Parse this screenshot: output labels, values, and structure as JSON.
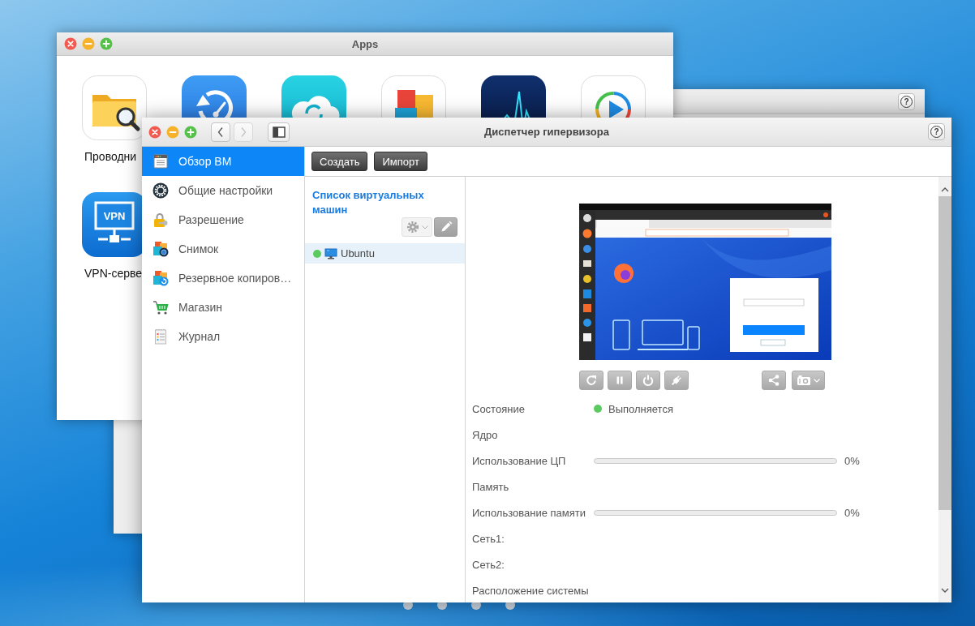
{
  "apps_window": {
    "title": "Apps",
    "apps": [
      {
        "kind": "explorer",
        "label": "Проводни"
      },
      {
        "kind": "backup"
      },
      {
        "kind": "cloud"
      },
      {
        "kind": "blocks"
      },
      {
        "kind": "pulse"
      },
      {
        "kind": "player"
      },
      {
        "kind": "vpn",
        "icon_text": "VPN",
        "label": "VPN-серве"
      }
    ]
  },
  "background_window": {
    "help_button": "?"
  },
  "hypervisor_window": {
    "title": "Диспетчер гипервизора",
    "help_button": "?",
    "nav_buttons": [
      {
        "kind": "back",
        "disabled": false
      },
      {
        "kind": "forward",
        "disabled": true
      }
    ],
    "sidebar": [
      {
        "kind": "overview",
        "label": "Обзор ВМ",
        "selected": true
      },
      {
        "kind": "settings",
        "label": "Общие настройки",
        "selected": false
      },
      {
        "kind": "permission",
        "label": "Разрешение",
        "selected": false
      },
      {
        "kind": "snapshot",
        "label": "Снимок",
        "selected": false
      },
      {
        "kind": "backup",
        "label": "Резервное копиров…",
        "selected": false
      },
      {
        "kind": "store",
        "label": "Магазин",
        "selected": false
      },
      {
        "kind": "log",
        "label": "Журнал",
        "selected": false
      }
    ],
    "toolbar": [
      "Создать",
      "Импорт"
    ],
    "vm_list": {
      "title": "Список виртуальных машин",
      "vms": [
        {
          "name": "Ubuntu",
          "running": true,
          "selected": true
        }
      ]
    },
    "console_buttons": [
      {
        "kind": "restart"
      },
      {
        "kind": "pause"
      },
      {
        "kind": "power"
      },
      {
        "kind": "plug"
      }
    ],
    "side_buttons": [
      {
        "kind": "share"
      },
      {
        "kind": "camera"
      }
    ],
    "details": [
      {
        "kind": "status",
        "label": "Состояние",
        "value": "Выполняется",
        "running": true
      },
      {
        "kind": "text",
        "label": "Ядро"
      },
      {
        "kind": "meter",
        "label": "Использование ЦП",
        "level": 0,
        "reading": "0%"
      },
      {
        "kind": "text",
        "label": "Память"
      },
      {
        "kind": "meter",
        "label": "Использование памяти",
        "level": 0,
        "reading": "0%"
      },
      {
        "kind": "text",
        "label": "Сеть1:"
      },
      {
        "kind": "text",
        "label": "Сеть2:"
      },
      {
        "kind": "text",
        "label": "Расположение системы"
      }
    ]
  }
}
